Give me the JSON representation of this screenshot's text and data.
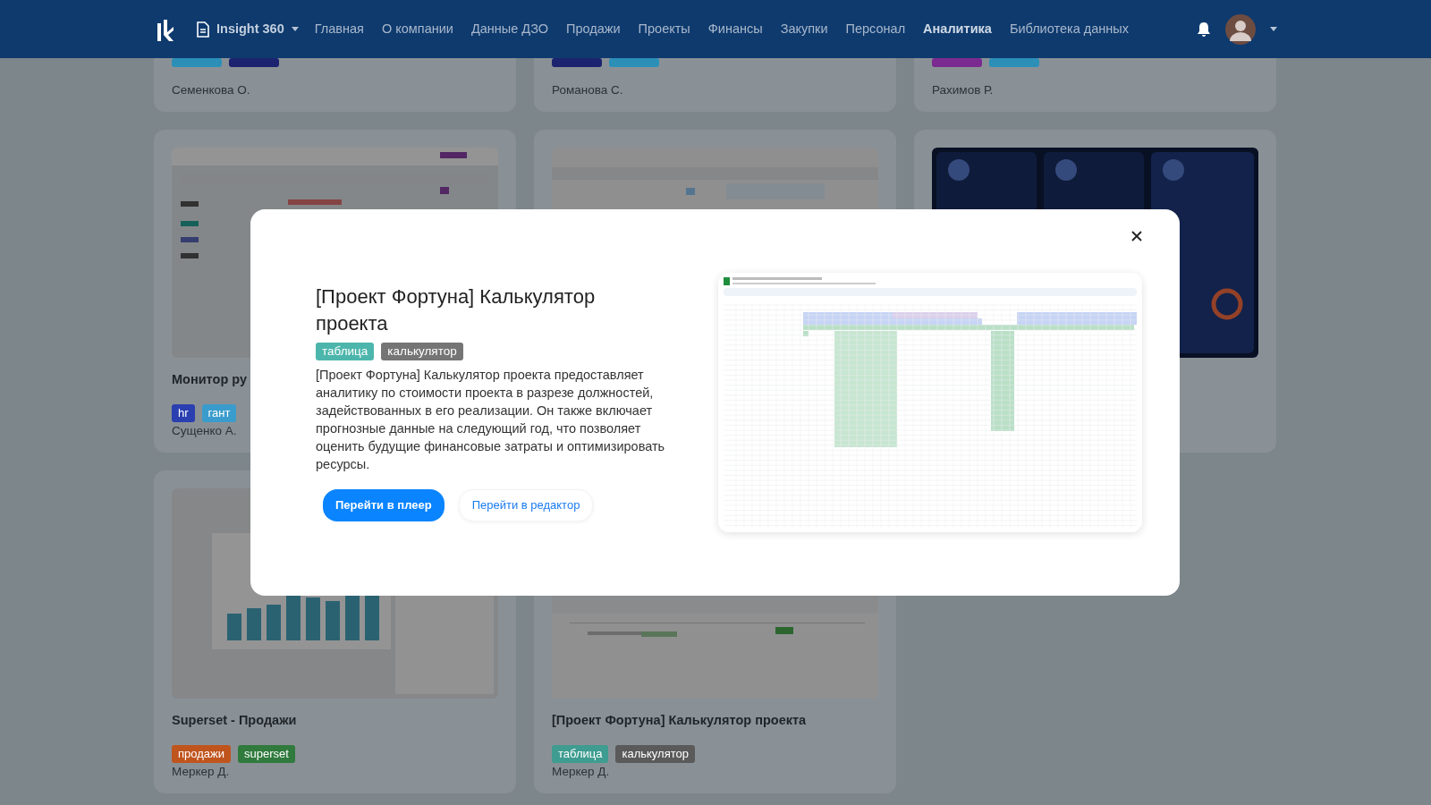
{
  "navbar": {
    "brand": "Insight 360",
    "menu": [
      {
        "label": "Главная",
        "selected": false
      },
      {
        "label": "О компании",
        "selected": false
      },
      {
        "label": "Данные ДЗО",
        "selected": false
      },
      {
        "label": "Продажи",
        "selected": false
      },
      {
        "label": "Проекты",
        "selected": false
      },
      {
        "label": "Финансы",
        "selected": false
      },
      {
        "label": "Закупки",
        "selected": false
      },
      {
        "label": "Персонал",
        "selected": false
      },
      {
        "label": "Аналитика",
        "selected": true
      },
      {
        "label": "Библиотека данных",
        "selected": false
      }
    ]
  },
  "cards": [
    {
      "tags": [
        {
          "color": "#2b8fb8"
        },
        {
          "color": "#1c2470"
        }
      ],
      "author": "Семенкова О."
    },
    {
      "tags": [
        {
          "color": "#1c2470"
        },
        {
          "color": "#2b8fb8"
        }
      ],
      "author": "Романова С."
    },
    {
      "tags": [
        {
          "color": "#7b2a8f"
        },
        {
          "color": "#2b8fb8"
        }
      ],
      "author": "Рахимов Р."
    },
    {
      "thumbnail": {
        "kind": "picture"
      },
      "title": "Монитор ру",
      "tags": [
        {
          "label": "hr",
          "color": "#2a3fb0"
        },
        {
          "label": "гант",
          "color": "#3a9ccc"
        }
      ],
      "author": "Сущенко А."
    },
    {
      "thumbnail": {
        "kind": "picture"
      }
    },
    {
      "thumbnail": {
        "kind": "picture"
      }
    },
    {
      "thumbnail": {
        "kind": "picture"
      },
      "title": "Superset - Продажи",
      "tags": [
        {
          "label": "продажи",
          "color": "#c0541d"
        },
        {
          "label": "superset",
          "color": "#2f7a3c"
        }
      ],
      "author": "Меркер Д."
    },
    {
      "thumbnail": {
        "kind": "picture"
      },
      "title": "[Проект Фортуна] Калькулятор проекта",
      "tags": [
        {
          "label": "таблица",
          "color": "#3e9c90"
        },
        {
          "label": "калькулятор",
          "color": "#5a5a5a"
        }
      ],
      "author": "Меркер Д."
    }
  ],
  "modal": {
    "title": "[Проект Фортуна] Калькулятор проекта",
    "tags": [
      {
        "label": "таблица",
        "color": "#4db6ac"
      },
      {
        "label": "калькулятор",
        "color": "#757575"
      }
    ],
    "description": "[Проект Фортуна] Калькулятор проекта предоставляет аналитику по стоимости проекта в разрезе должностей, задействованных в его реализации. Он также включает прогнозные данные на следующий год, что позволяет оценить будущие финансовые затраты и оптимизировать ресурсы.",
    "buttons": [
      {
        "label": "Перейти в плеер",
        "kind": "primary"
      },
      {
        "label": "Перейти в редактор",
        "kind": "link"
      }
    ]
  }
}
